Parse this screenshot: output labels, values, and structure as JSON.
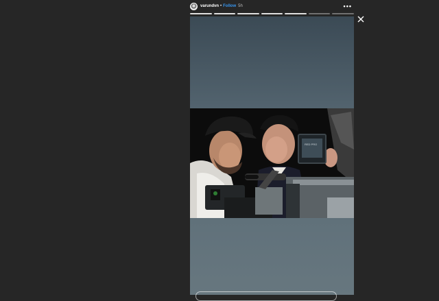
{
  "story": {
    "username": "varundvn",
    "separator": "•",
    "follow_label": "Follow",
    "time_ago": "5h",
    "more_icon": "more-horizontal-icon",
    "close_icon": "close-icon",
    "progress": {
      "total_segments": 7,
      "viewed_segments": 5
    },
    "photo_monitor_text": "RED PRO"
  },
  "colors": {
    "background": "#262626",
    "follow": "#3897f0",
    "backdrop_top": "#3b4a55",
    "backdrop_bottom": "#67777f"
  }
}
